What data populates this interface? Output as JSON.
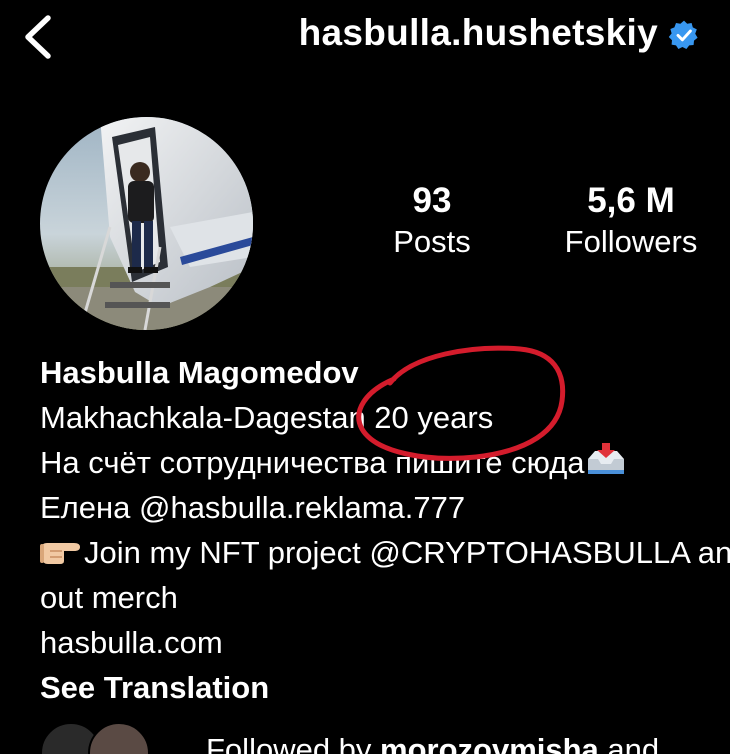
{
  "header": {
    "username": "hasbulla.hushetskiy",
    "back_icon": "chevron-left-icon",
    "verified_icon": "verified-badge-icon",
    "verified_color": "#3897f0"
  },
  "stats": {
    "posts_value": "93",
    "posts_label": "Posts",
    "followers_value": "5,6 M",
    "followers_label": "Followers"
  },
  "bio": {
    "name": "Hasbulla Magomedov",
    "line1": "Makhachkala-Dagestan 20 years",
    "line2": "На счёт сотрудничества пишите сюда",
    "line2_emoji": "inbox-tray-icon",
    "line3": "Елена @hasbulla.reklama.777",
    "line4": "Join my NFT project @CRYPTOHASBULLA and check",
    "line4_emoji": "pointing-hand-icon",
    "line5": "out merch",
    "link": "hasbulla.com",
    "see_translation": "See Translation"
  },
  "annotation": {
    "color": "#d41c2c"
  },
  "followed_by": {
    "prefix": "Followed by ",
    "user": "morozovmisha",
    "suffix": " and"
  }
}
